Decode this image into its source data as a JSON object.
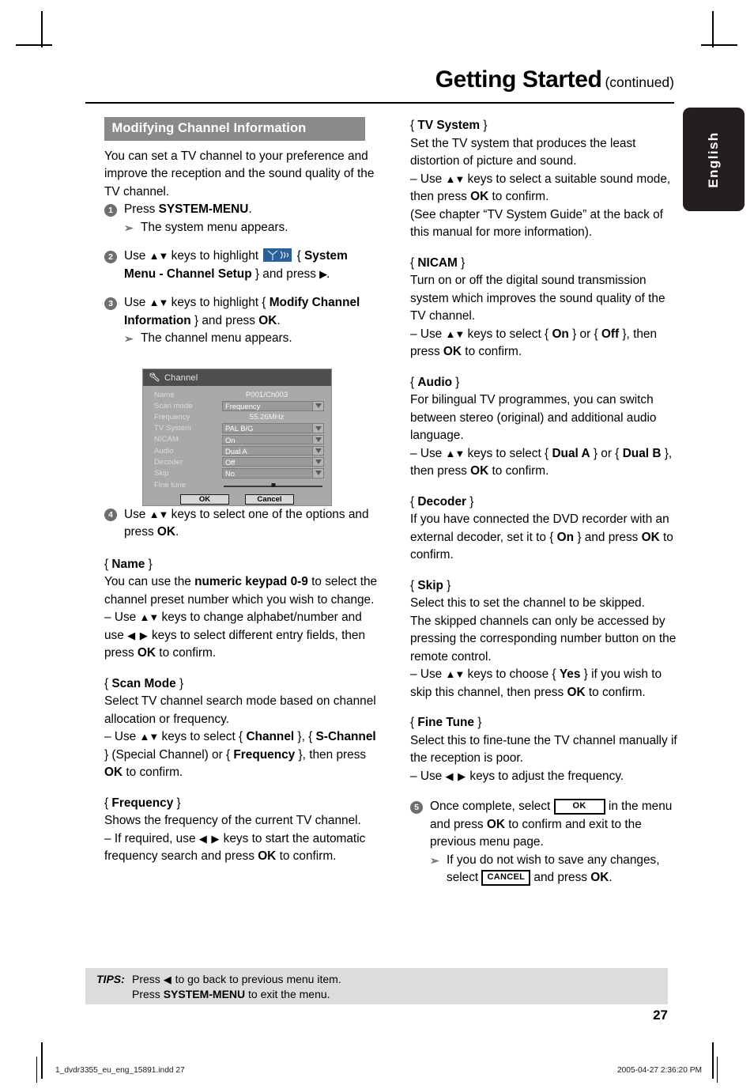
{
  "header": {
    "title": "Getting Started",
    "continued": "(continued)"
  },
  "lang_tab": {
    "label": "English"
  },
  "left_column": {
    "section_heading": "Modifying Channel Information",
    "intro": "You can set a TV channel to your preference and improve the reception and the sound quality of the TV channel.",
    "steps": [
      {
        "num": "1",
        "text_pre": "Press ",
        "text_bold": "SYSTEM-MENU",
        "text_post": ".",
        "sub": "The system menu appears."
      },
      {
        "num": "2",
        "seg1": "Use ",
        "keys": "▲▼",
        "seg2": " keys to highlight ",
        "icon": "channel-setup-icon",
        "seg3": " { ",
        "bold": "System Menu - Channel Setup",
        "seg4": " } and press ",
        "arrow": "▶",
        "seg5": "."
      },
      {
        "num": "3",
        "seg1": "Use ",
        "keys": "▲▼",
        "seg2": " keys to highlight { ",
        "bold": "Modify Channel Information",
        "seg3": " } and press ",
        "bold2": "OK",
        "seg4": ".",
        "sub": "The channel menu appears."
      },
      {
        "num": "4",
        "seg1": "Use ",
        "keys": "▲▼",
        "seg2": " keys to select one of the options and press ",
        "bold": "OK",
        "seg3": "."
      }
    ],
    "options": [
      {
        "title": "Name",
        "lines": [
          "You can use the |b|numeric keypad 0-9|/b| to select the channel preset number which you wish to change.",
          "– Use |k|▲▼|/k| keys to change alphabet/number and use |k2|◀ ▶|/k2| keys to select different entry fields, then press |b|OK|/b| to confirm."
        ]
      },
      {
        "title": "Scan Mode",
        "lines": [
          "Select TV channel search mode based on channel allocation or frequency.",
          "– Use |k|▲▼|/k| keys to select { |b|Channel|/b| }, { |b|S-Channel|/b| } (Special Channel) or { |b|Frequency|/b| }, then press |b|OK|/b| to confirm."
        ]
      },
      {
        "title": "Frequency",
        "lines": [
          "Shows the frequency of the current TV channel.",
          "– If required, use |k2|◀ ▶|/k2| keys to start the automatic frequency search and press |b|OK|/b| to confirm."
        ]
      }
    ]
  },
  "dialog": {
    "icon": "wrench-icon",
    "title": "Channel",
    "rows": [
      {
        "label": "Name",
        "value": "P001/Ch003",
        "type": "plain"
      },
      {
        "label": "Scan mode",
        "value": "Frequency",
        "type": "combo"
      },
      {
        "label": "Frequency",
        "value": "55.26MHz",
        "type": "plain"
      },
      {
        "label": "TV System",
        "value": "PAL B/G",
        "type": "combo"
      },
      {
        "label": "NICAM",
        "value": "On",
        "type": "combo"
      },
      {
        "label": "Audio",
        "value": "Dual A",
        "type": "combo"
      },
      {
        "label": "Decoder",
        "value": "Off",
        "type": "combo"
      },
      {
        "label": "Skip",
        "value": "No",
        "type": "combo"
      },
      {
        "label": "Fine tune",
        "value": "",
        "type": "slider"
      }
    ],
    "ok_label": "OK",
    "cancel_label": "Cancel"
  },
  "right_column": {
    "options": [
      {
        "title": "TV System",
        "lines": [
          "Set the TV system that produces the least distortion of picture and sound.",
          "– Use |k|▲▼|/k| keys to select a suitable sound mode, then press |b|OK|/b| to confirm.",
          "(See chapter “TV System Guide” at the back of this manual for more information)."
        ]
      },
      {
        "title": "NICAM",
        "lines": [
          "Turn on or off the digital sound transmission system which improves the sound quality of the TV channel.",
          "– Use |k|▲▼|/k| keys to select { |b|On|/b| } or { |b|Off|/b| }, then press |b|OK|/b| to confirm."
        ]
      },
      {
        "title": "Audio",
        "lines": [
          "For bilingual TV programmes, you can switch between stereo (original) and additional audio language.",
          "– Use |k|▲▼|/k| keys to select { |b|Dual A|/b| } or { |b|Dual B|/b| }, then press |b|OK|/b| to confirm."
        ]
      },
      {
        "title": "Decoder",
        "lines": [
          "If you have connected the DVD recorder with an external decoder, set it to { |b|On|/b| } and press |b|OK|/b| to confirm."
        ]
      },
      {
        "title": "Skip",
        "lines": [
          "Select this to set the channel to be skipped.",
          "The skipped channels can only be accessed by pressing the corresponding number button on the remote control.",
          "– Use |k|▲▼|/k| keys to choose { |b|Yes|/b| } if you wish to skip this channel, then press |b|OK|/b| to confirm."
        ]
      },
      {
        "title": "Fine Tune",
        "lines": [
          "Select this to fine-tune the TV channel manually if the reception is poor.",
          "– Use |k2|◀ ▶|/k2| keys to adjust the frequency."
        ]
      }
    ],
    "step5": {
      "num": "5",
      "seg1": "Once complete, select ",
      "key_ok": "OK",
      "seg2": " in the menu and press ",
      "bold_ok": "OK",
      "seg3": " to confirm and exit to the previous menu page.",
      "sub_seg1": "If you do not wish to save any changes, select ",
      "key_cancel": "CANCEL",
      "sub_seg2": " and press ",
      "sub_bold": "OK",
      "sub_seg3": "."
    }
  },
  "tips": {
    "label": "TIPS:",
    "line1_pre": "Press ",
    "line1_arrow": "◀",
    "line1_post": " to go back to previous menu item.",
    "line2_pre": "Press ",
    "line2_bold": "SYSTEM-MENU",
    "line2_post": " to exit the menu."
  },
  "page_number": "27",
  "footer": {
    "left": "1_dvdr3355_eu_eng_15891.indd   27",
    "right": "2005-04-27   2:36:20 PM"
  }
}
